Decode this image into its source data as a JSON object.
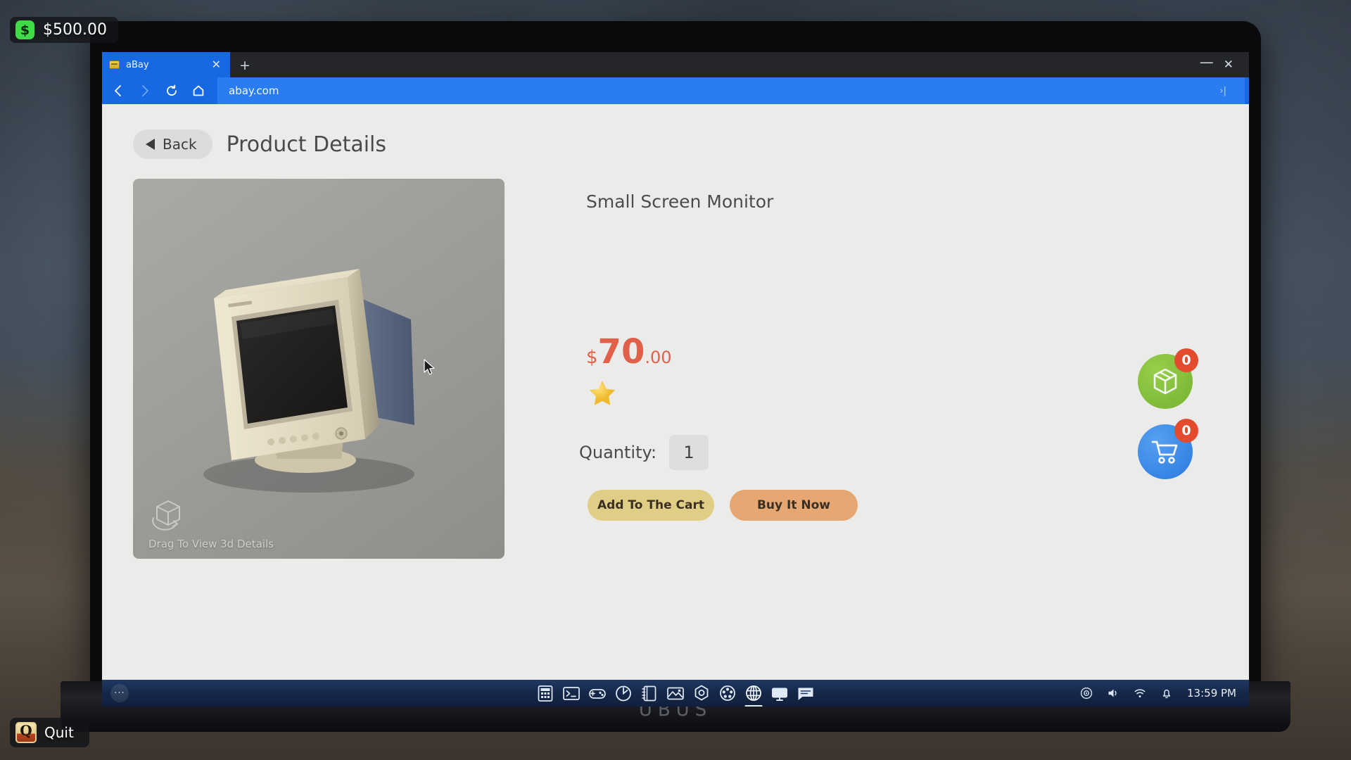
{
  "hud": {
    "money": "$500.00",
    "money_icon": "dollar-icon",
    "quit_key": "Q",
    "quit_label": "Quit"
  },
  "laptop": {
    "brand": "UBUS"
  },
  "browser": {
    "tab": {
      "title": "aBay",
      "favicon": "abay-favicon",
      "close_glyph": "✕"
    },
    "new_tab_glyph": "+",
    "window_controls": {
      "minimize": "—",
      "close": "✕"
    },
    "nav": {
      "back_icon": "chevron-left-icon",
      "forward_icon": "chevron-right-icon",
      "reload_icon": "reload-icon",
      "home_icon": "home-icon"
    },
    "url": "abay.com",
    "url_expand_glyph": "›|"
  },
  "page": {
    "back_button": "Back",
    "title": "Product Details",
    "viewer": {
      "drag_hint": "Drag To View 3d Details",
      "hint_icon": "rotate-cube-icon",
      "product_image": "crt-monitor-3d-model"
    },
    "product": {
      "name": "Small Screen Monitor",
      "price_currency": "$",
      "price_main": "70",
      "price_cents": ".00",
      "price_color": "#e0604a",
      "rating_stars": 1,
      "star_color": "#f5c845",
      "quantity_label": "Quantity:",
      "quantity_value": "1"
    },
    "actions": {
      "add_to_cart": "Add To The Cart",
      "add_to_cart_color": "#e0ce86",
      "buy_now": "Buy It Now",
      "buy_now_color": "#e7a773"
    },
    "badges": [
      {
        "name": "package",
        "icon": "package-box-icon",
        "count": "0",
        "color": "#84c23c"
      },
      {
        "name": "cart",
        "icon": "shopping-cart-icon",
        "count": "0",
        "color": "#3284e4"
      }
    ]
  },
  "taskbar": {
    "start_glyph": "···",
    "apps": [
      {
        "name": "calculator-icon"
      },
      {
        "name": "terminal-icon"
      },
      {
        "name": "gamepad-icon"
      },
      {
        "name": "power-icon"
      },
      {
        "name": "notebook-icon"
      },
      {
        "name": "image-editor-icon"
      },
      {
        "name": "settings-hex-icon"
      },
      {
        "name": "media-reel-icon"
      },
      {
        "name": "browser-globe-icon"
      },
      {
        "name": "monitor-icon"
      },
      {
        "name": "chat-icon"
      }
    ],
    "tray": [
      {
        "name": "disc-icon"
      },
      {
        "name": "volume-icon"
      },
      {
        "name": "wifi-icon"
      },
      {
        "name": "bell-icon"
      }
    ],
    "clock": "13:59 PM"
  }
}
